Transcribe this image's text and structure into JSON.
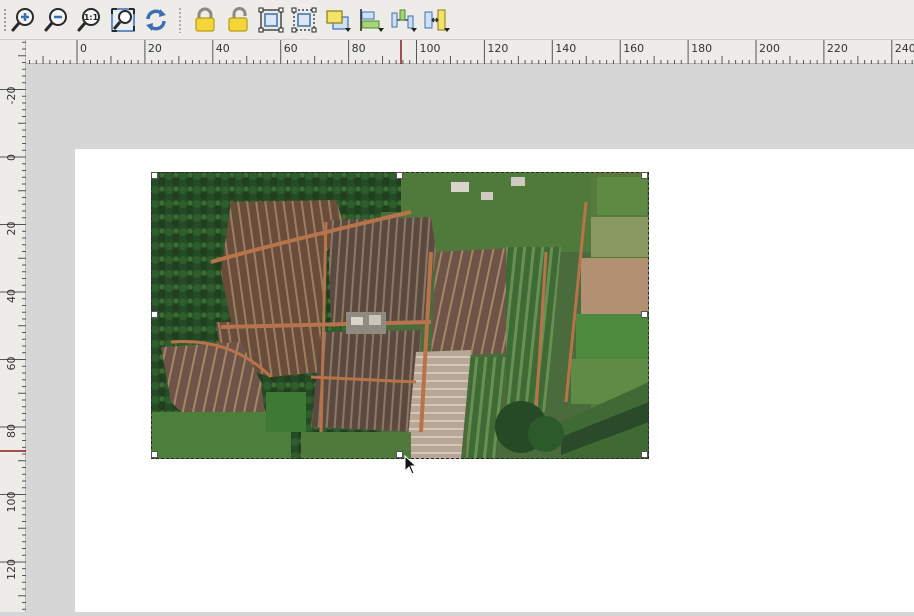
{
  "toolbar": {
    "buttons": [
      {
        "name": "zoom-in-button",
        "icon": "zoom-in-icon"
      },
      {
        "name": "zoom-out-button",
        "icon": "zoom-out-icon"
      },
      {
        "name": "zoom-actual-button",
        "icon": "zoom-actual-icon",
        "label": "1:1"
      },
      {
        "name": "zoom-full-button",
        "icon": "zoom-full-icon"
      },
      {
        "name": "refresh-button",
        "icon": "refresh-icon"
      },
      {
        "name": "lock-items-button",
        "icon": "lock-closed-icon"
      },
      {
        "name": "unlock-items-button",
        "icon": "lock-open-icon"
      },
      {
        "name": "group-items-button",
        "icon": "group-icon"
      },
      {
        "name": "ungroup-items-button",
        "icon": "ungroup-icon"
      },
      {
        "name": "raise-items-button",
        "icon": "raise-icon"
      },
      {
        "name": "align-left-button",
        "icon": "align-left-icon"
      },
      {
        "name": "distribute-button",
        "icon": "distribute-icon"
      },
      {
        "name": "resize-button",
        "icon": "resize-icon"
      }
    ]
  },
  "rulers": {
    "horizontal_labels": [
      "0",
      "20",
      "40",
      "60",
      "80",
      "100",
      "120",
      "140",
      "160",
      "180",
      "200",
      "220",
      "240"
    ],
    "vertical_labels": [
      "-20",
      "0",
      "20",
      "40",
      "60",
      "80",
      "100",
      "120"
    ]
  },
  "colors": {
    "toolbar_bg": "#edece8",
    "canvas_bg": "#d6d6d6",
    "page_bg": "#ffffff",
    "cursor_marker": "#8b1a1a"
  }
}
